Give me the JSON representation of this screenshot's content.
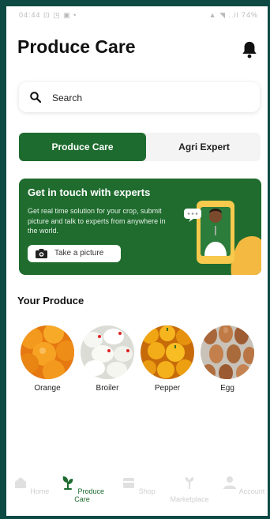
{
  "status_bar": {
    "left": "04:44 ⊡ ◳ ▣ •",
    "right": "▲ ◥ ..il 74%"
  },
  "header": {
    "title": "Produce Care"
  },
  "search": {
    "placeholder": "Search"
  },
  "tabs": [
    {
      "label": "Produce Care",
      "active": true
    },
    {
      "label": "Agri Expert",
      "active": false
    }
  ],
  "banner": {
    "heading": "Get in touch with experts",
    "body": "Get real time solution for your crop, submit picture and talk to experts from anywhere in the world.",
    "button_label": "Take a picture"
  },
  "produce_section": {
    "heading": "Your Produce",
    "items": [
      {
        "label": "Orange",
        "icon": "orange-image"
      },
      {
        "label": "Broiler",
        "icon": "broiler-image"
      },
      {
        "label": "Pepper",
        "icon": "pepper-image"
      },
      {
        "label": "Egg",
        "icon": "egg-image"
      }
    ]
  },
  "bottom_nav": [
    {
      "label": "Home",
      "icon": "home-icon",
      "active": false
    },
    {
      "label": "Produce Care",
      "icon": "plant-icon",
      "active": true
    },
    {
      "label": "Shop",
      "icon": "shop-icon",
      "active": false
    },
    {
      "label": "Marketplace",
      "icon": "farm-icon",
      "active": false
    },
    {
      "label": "Account",
      "icon": "account-icon",
      "active": false
    }
  ],
  "colors": {
    "primary": "#1e6b2f",
    "frame": "#0d4a44"
  }
}
